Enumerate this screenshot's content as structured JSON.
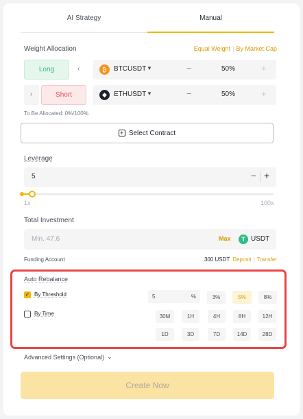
{
  "tabs": [
    {
      "label": "AI Strategy"
    },
    {
      "label": "Manual"
    }
  ],
  "weight": {
    "title": "Weight Allocation",
    "equal_weight": "Equal Weight",
    "by_market_cap": "By Market Cap",
    "separator": "|",
    "rows": [
      {
        "side": "Long",
        "symbol": "BTCUSDT",
        "coin_glyph": "₿",
        "coin_color": "#f7931a",
        "percent": "50%"
      },
      {
        "side": "Short",
        "symbol": "ETHUSDT",
        "coin_glyph": "◆",
        "coin_color": "#1e2329",
        "percent": "50%"
      }
    ],
    "to_be_allocated": "To Be Allocated: 0%/100%"
  },
  "select_contract": "Select Contract",
  "leverage": {
    "title": "Leverage",
    "value": "5",
    "min_label": "1x",
    "max_label": "100x",
    "level_fraction": 0.04
  },
  "investment": {
    "title": "Total Investment",
    "placeholder": "Min. 47.6",
    "max": "Max",
    "currency": "USDT",
    "currency_color": "#2ebd85"
  },
  "funding": {
    "label": "Funding Account",
    "balance": "300 USDT",
    "deposit": "Deposit",
    "transfer": "Transfer"
  },
  "auto_rebalance": {
    "title": "Auto Rebalance",
    "by_threshold": "By Threshold",
    "by_time": "By Time",
    "threshold_value": "5",
    "threshold_unit": "%",
    "threshold_options": [
      "3%",
      "5%",
      "8%"
    ],
    "selected_threshold": "5%",
    "time_options_row1": [
      "30M",
      "1H",
      "4H",
      "8H",
      "12H"
    ],
    "time_options_row2": [
      "1D",
      "3D",
      "7D",
      "14D",
      "28D"
    ]
  },
  "advanced": "Advanced Settings (Optional)",
  "create": "Create Now",
  "colors": {
    "accent": "#f0b90b",
    "long": "#2ebd85",
    "short": "#f6465d",
    "highlight": "#e84444"
  }
}
